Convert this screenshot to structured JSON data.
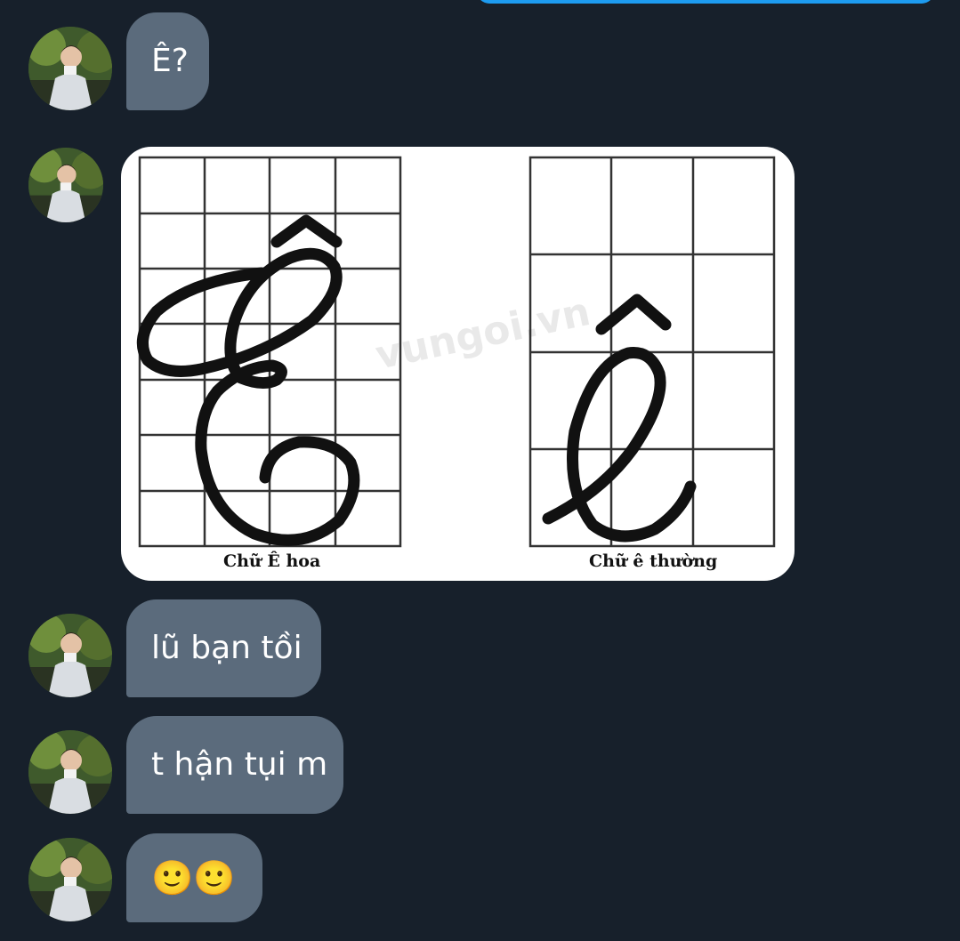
{
  "conversation": {
    "messages": [
      {
        "type": "text",
        "text": "Ê?"
      },
      {
        "type": "image",
        "captions": {
          "upper": "Chữ Ê hoa",
          "lower": "Chữ ê thường"
        },
        "watermark": "vungoi.vn"
      },
      {
        "type": "text",
        "text": "lũ bạn tồi"
      },
      {
        "type": "text",
        "text": "t hận tụi m"
      },
      {
        "type": "text",
        "text": "🙂🙂"
      }
    ]
  },
  "colors": {
    "background": "#17202b",
    "bubble": "#5b6b7c",
    "sent_bubble": "#1d9bf0"
  }
}
